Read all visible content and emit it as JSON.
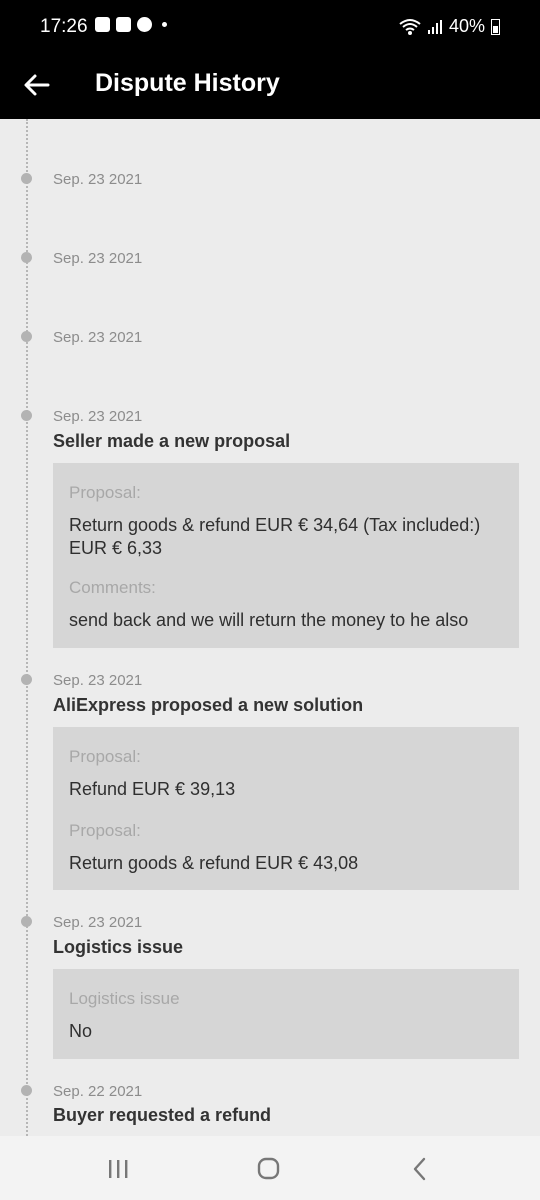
{
  "status_bar": {
    "time": "17:26",
    "battery": "40%"
  },
  "app_bar": {
    "title": "Dispute History"
  },
  "entries": [
    {
      "date": "Sep. 23 2021"
    },
    {
      "date": "Sep. 23 2021"
    },
    {
      "date": "Sep. 23 2021"
    },
    {
      "date": "Sep. 23 2021",
      "title": "Seller made a new proposal",
      "fields": [
        {
          "label": "Proposal:",
          "value": "Return goods & refund EUR € 34,64 (Tax included:) EUR € 6,33"
        },
        {
          "label": "Comments:",
          "value": "send back and we will return the money to he also"
        }
      ]
    },
    {
      "date": "Sep. 23 2021",
      "title": "AliExpress proposed a new solution",
      "fields": [
        {
          "label": "Proposal:",
          "value": "Refund EUR € 39,13"
        },
        {
          "label": "Proposal:",
          "value": "Return goods & refund EUR € 43,08"
        }
      ]
    },
    {
      "date": "Sep. 23 2021",
      "title": "Logistics issue",
      "fields": [
        {
          "label": "Logistics issue",
          "value": "No"
        }
      ]
    },
    {
      "date": "Sep. 22 2021",
      "title": "Buyer requested a refund"
    }
  ],
  "nav_bar": {
    "icons": [
      "recents-icon",
      "home-icon",
      "back-icon"
    ]
  }
}
